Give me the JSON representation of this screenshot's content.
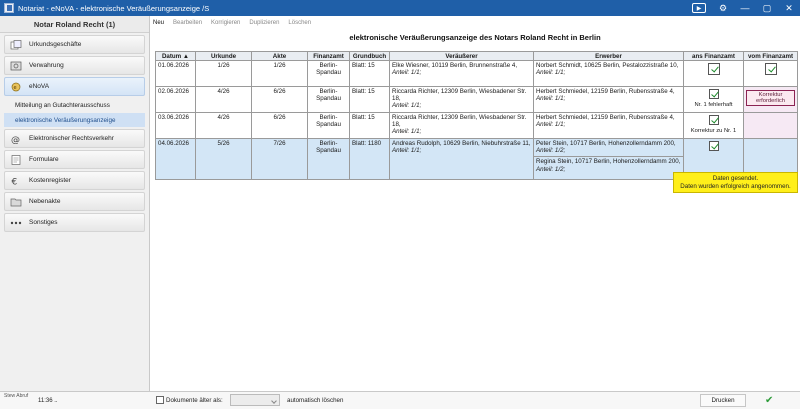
{
  "window": {
    "title": "Notariat - eNoVA - elektronische Veräußerungsanzeige /S"
  },
  "sidebar": {
    "header": "Notar Roland Recht (1)",
    "items": [
      {
        "label": "Urkundsgeschäfte",
        "icon": "documents-icon"
      },
      {
        "label": "Verwahrung",
        "icon": "safe-icon"
      },
      {
        "label": "eNoVA",
        "icon": "enova-icon"
      },
      {
        "label": "Elektronischer Rechtsverkehr",
        "icon": "at-icon"
      },
      {
        "label": "Formulare",
        "icon": "form-icon"
      },
      {
        "label": "Kostenregister",
        "icon": "euro-icon"
      },
      {
        "label": "Nebenakte",
        "icon": "folder-icon"
      },
      {
        "label": "Sonstiges",
        "icon": "dots-icon"
      }
    ],
    "subitems": [
      {
        "label": "Mitteilung an Gutachterausschuss"
      },
      {
        "label": "elektronische Veräußerungsanzeige"
      }
    ]
  },
  "toolbar": {
    "neu": "Neu",
    "bearbeiten": "Bearbeiten",
    "korrigieren": "Korrigieren",
    "duplizieren": "Duplizieren",
    "loeschen": "Löschen"
  },
  "heading": "elektronische Veräußerungsanzeige des Notars Roland Recht in Berlin",
  "table": {
    "headers": [
      "Datum ▲",
      "Urkunde",
      "Akte",
      "Finanzamt",
      "Grundbuch",
      "Veräußerer",
      "Erwerber",
      "ans Finanzamt",
      "vom Finanzamt"
    ],
    "rows": [
      {
        "datum": "01.06.2026",
        "urkunde": "1/26",
        "akte": "1/26",
        "finanzamt": "Berlin-Spandau",
        "grundbuch": "Blatt: 15",
        "veraeusserer": "Elke Wiesner, 10119 Berlin, Brunnenstraße 4,",
        "veraeusserer_anteil": "Anteil: 1/1;",
        "erwerber": "Norbert Schmidt, 10625 Berlin, Pestalozzistraße 10,",
        "erwerber_anteil": "Anteil: 1/1;"
      },
      {
        "datum": "02.06.2026",
        "urkunde": "4/26",
        "akte": "6/26",
        "finanzamt": "Berlin-Spandau",
        "grundbuch": "Blatt: 15",
        "veraeusserer": "Riccarda Richter, 12309 Berlin, Wiesbadener Str. 18,",
        "veraeusserer_anteil": "Anteil: 1/1;",
        "erwerber": "Herbert Schmiedel, 12159 Berlin, Rubensstraße 4,",
        "erwerber_anteil": "Anteil: 1/1;",
        "status_note": "Nr. 1 fehlerhaft",
        "vom_button": "Korrektur erforderlich"
      },
      {
        "datum": "03.06.2026",
        "urkunde": "4/26",
        "akte": "6/26",
        "finanzamt": "Berlin-Spandau",
        "grundbuch": "Blatt: 15",
        "veraeusserer": "Riccarda Richter, 12309 Berlin, Wiesbadener Str. 18,",
        "veraeusserer_anteil": "Anteil: 1/1;",
        "erwerber": "Herbert Schmiedel, 12159 Berlin, Rubensstraße 4,",
        "erwerber_anteil": "Anteil: 1/1;",
        "status_note": "Korrektur zu Nr. 1"
      },
      {
        "datum": "04.06.2026",
        "urkunde": "5/26",
        "akte": "7/26",
        "finanzamt": "Berlin-Spandau",
        "grundbuch": "Blatt: 1180",
        "veraeusserer": "Andreas Rudolph, 10629 Berlin, Niebuhrstraße 11,",
        "veraeusserer_anteil": "Anteil: 1/1;",
        "erwerber": "Peter Stein, 10717 Berlin, Hohenzollerndamm 200,",
        "erwerber_anteil": "Anteil: 1/2;",
        "erwerber2": "Regina Stein, 10717 Berlin, Hohenzollerndamm 200,",
        "erwerber2_anteil": "Anteil: 1/2;"
      }
    ]
  },
  "tooltip": {
    "line1": "Daten gesendet.",
    "line2": "Daten wurden erfolgreich angenommen."
  },
  "statusbar": {
    "label": "Stew Abruf",
    "time": "11:36 ..",
    "docs_label": "Dokumente älter als:",
    "auto_label": "automatisch löschen",
    "print_label": "Drucken"
  },
  "colors": {
    "titlebar": "#1f5fa8",
    "selected_row": "#d3e6f6",
    "tooltip": "#ffef1a",
    "check": "#1b8a2a"
  }
}
